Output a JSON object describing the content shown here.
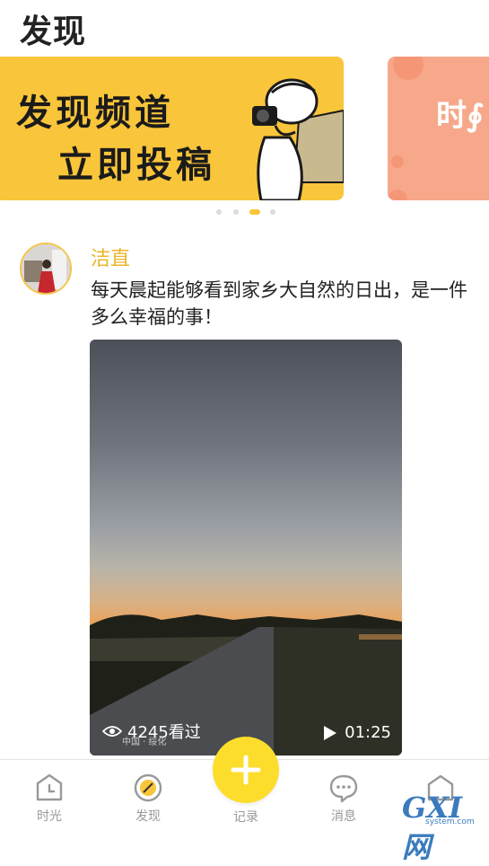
{
  "header": {
    "title": "发现"
  },
  "banners": [
    {
      "line1": "发现频道",
      "line2": "立即投稿"
    },
    {
      "text": "时∮"
    }
  ],
  "carousel": {
    "count": 4,
    "active_index": 2
  },
  "post": {
    "author": "洁直",
    "text": "每天晨起能够看到家乡大自然的日出，是一件多么幸福的事！",
    "view_count": "4245看过",
    "location": "中国 · 绥化",
    "duration": "01:25"
  },
  "nav": {
    "items": [
      {
        "label": "时光",
        "icon": "clock-icon"
      },
      {
        "label": "发现",
        "icon": "compass-icon"
      },
      {
        "label": "记录",
        "icon": "plus-icon"
      },
      {
        "label": "消息",
        "icon": "chat-bubble-icon"
      }
    ]
  },
  "watermark": {
    "big": "GXI网",
    "small": "system.com"
  },
  "colors": {
    "accent": "#f9c53a",
    "author": "#e9b62c",
    "fab": "#fddd2c",
    "banner_secondary": "#f7a88b"
  }
}
